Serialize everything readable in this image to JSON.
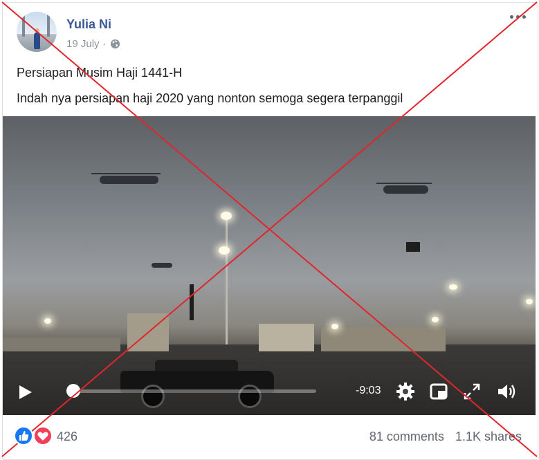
{
  "post": {
    "author": "Yulia Ni",
    "date": "19 July",
    "separator": "·",
    "privacy_icon": "globe-icon",
    "title_line": "Persiapan Musim Haji 1441-H",
    "body_line": "Indah nya persiapan haji 2020 yang nonton semoga segera terpanggil"
  },
  "video": {
    "progress_fraction": 0.0,
    "time_remaining": "-9:03",
    "controls": [
      "play-icon",
      "settings-icon",
      "pip-icon",
      "fullscreen-icon",
      "volume-icon"
    ]
  },
  "reactions": {
    "icons": [
      "like-icon",
      "love-icon"
    ],
    "count": "426"
  },
  "stats": {
    "comments": "81 comments",
    "shares": "1.1K shares"
  },
  "overlay": {
    "cross_color": "#e0262c"
  },
  "colors": {
    "author": "#385898",
    "meta": "#8d949e",
    "like": "#1877f2",
    "love": "#f33e58"
  }
}
